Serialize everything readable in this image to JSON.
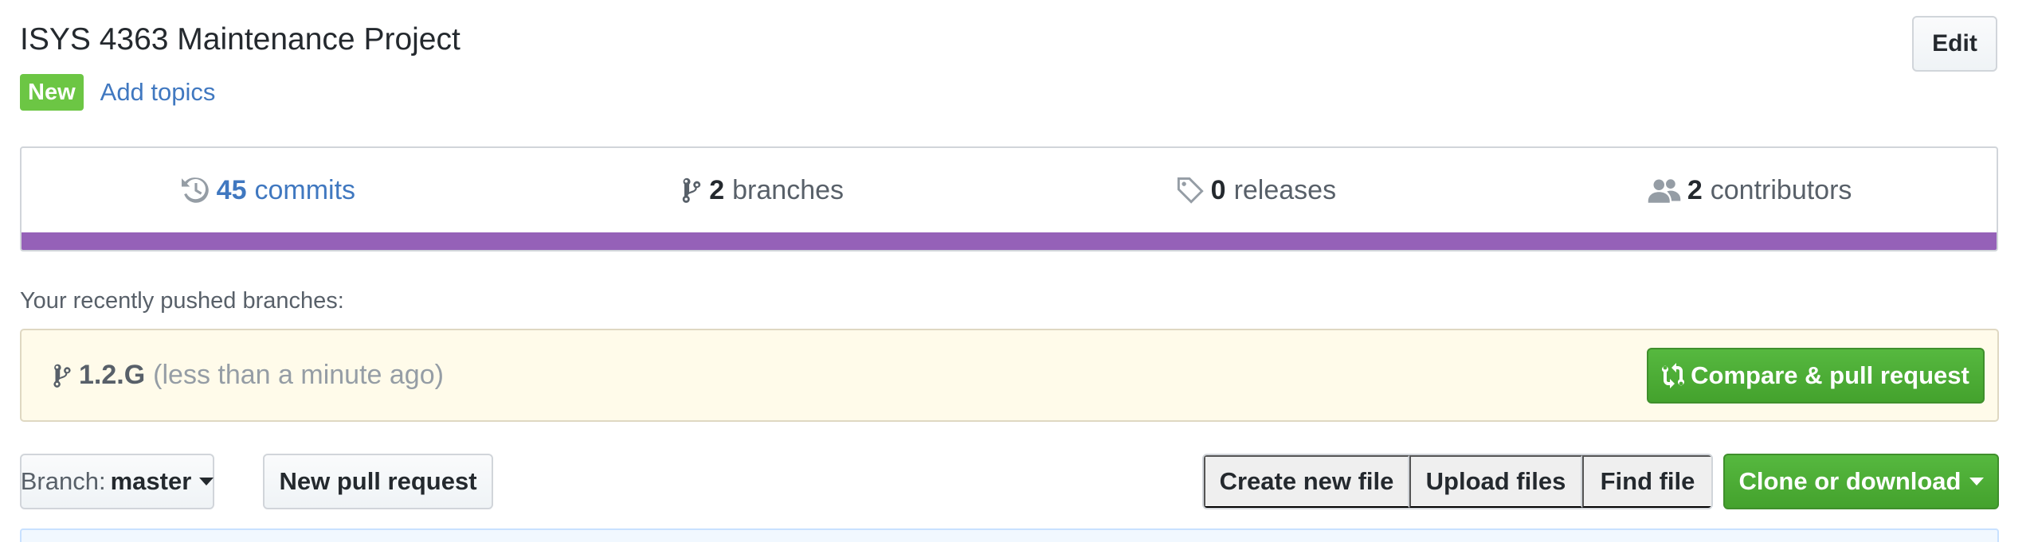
{
  "repo": {
    "title": "ISYS 4363 Maintenance Project",
    "edit_label": "Edit",
    "new_label": "New",
    "add_topics_label": "Add topics"
  },
  "summary": {
    "commits": {
      "count": "45",
      "label": "commits",
      "icon": "history-icon"
    },
    "branches": {
      "count": "2",
      "label": "branches",
      "icon": "git-branch-icon"
    },
    "releases": {
      "count": "0",
      "label": "releases",
      "icon": "tag-icon"
    },
    "contributors": {
      "count": "2",
      "label": "contributors",
      "icon": "people-icon"
    },
    "language_bar_color": "#9561b8"
  },
  "recent": {
    "label": "Your recently pushed branches:",
    "branch_name": "1.2.G",
    "branch_time": "(less than a minute ago)",
    "compare_label": "Compare & pull request"
  },
  "toolbar": {
    "branch_prefix": "Branch:",
    "branch_value": "master",
    "new_pr_label": "New pull request",
    "create_file_label": "Create new file",
    "upload_files_label": "Upload files",
    "find_file_label": "Find file",
    "clone_label": "Clone or download"
  },
  "colors": {
    "link": "#4078c0",
    "green": "#6cc644",
    "primary_button": "#44a22d",
    "recent_bg": "#fffbea"
  }
}
